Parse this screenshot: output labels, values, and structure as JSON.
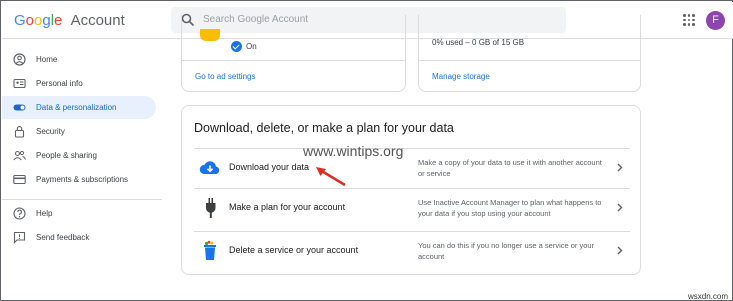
{
  "header": {
    "logo_google": "Google",
    "logo_account": "Account",
    "search_placeholder": "Search Google Account",
    "avatar_letter": "F",
    "colors": {
      "avatar": "#8e44ad"
    }
  },
  "sidebar": {
    "items": [
      {
        "label": "Home",
        "icon": "home-icon"
      },
      {
        "label": "Personal info",
        "icon": "person-card-icon"
      },
      {
        "label": "Data & personalization",
        "icon": "toggle-icon",
        "active": true
      },
      {
        "label": "Security",
        "icon": "lock-icon"
      },
      {
        "label": "People & sharing",
        "icon": "people-icon"
      },
      {
        "label": "Payments & subscriptions",
        "icon": "card-icon"
      },
      {
        "label": "Help",
        "icon": "help-icon"
      },
      {
        "label": "Send feedback",
        "icon": "feedback-icon"
      }
    ]
  },
  "ad_card": {
    "status": "On",
    "link": "Go to ad settings"
  },
  "storage_card": {
    "usage": "0% used – 0 GB of 15 GB",
    "link": "Manage storage"
  },
  "main_card": {
    "title": "Download, delete, or make a plan for your data",
    "rows": [
      {
        "title": "Download your data",
        "desc": "Make a copy of your data to use it with another account or service",
        "icon": "cloud-download-icon"
      },
      {
        "title": "Make a plan for your account",
        "desc": "Use Inactive Account Manager to plan what happens to your data if you stop using your account",
        "icon": "plug-icon"
      },
      {
        "title": "Delete a service or your account",
        "desc": "You can do this if you no longer use a service or your account",
        "icon": "trash-icon"
      }
    ]
  },
  "watermark": "www.wintips.org",
  "footer_watermark": "wsxdn.com"
}
